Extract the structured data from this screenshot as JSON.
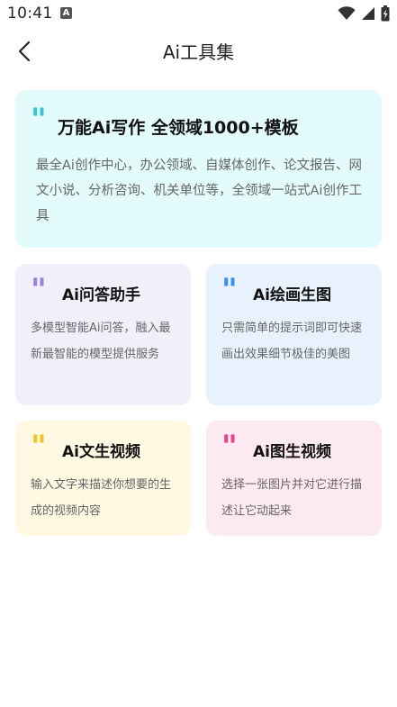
{
  "status_bar": {
    "time": "10:41",
    "notification_glyph": "A"
  },
  "header": {
    "title": "Ai工具集"
  },
  "cards": {
    "writing": {
      "title": "万能Ai写作 全领域1000+模板",
      "description": "最全Ai创作中心，办公领域、自媒体创作、论文报告、网文小说、分析咨询、机关单位等，全领域一站式Ai创作工具",
      "accent": "#34c7cf",
      "background": "#e3fbfb"
    },
    "qa": {
      "title": "Ai问答助手",
      "description": "多模型智能Ai问答，融入最新最智能的模型提供服务",
      "accent": "#9b7fe0",
      "background": "#f1effa"
    },
    "painting": {
      "title": "Ai绘画生图",
      "description": "只需简单的提示词即可快速画出效果细节极佳的美图",
      "accent": "#3b8ef0",
      "background": "#e7f2fd"
    },
    "text_video": {
      "title": "Ai文生视频",
      "description": "输入文字来描述你想要的生成的视频内容",
      "accent": "#f7c21c",
      "background": "#fff8e3"
    },
    "image_video": {
      "title": "Ai图生视频",
      "description": "选择一张图片并对它进行描述让它动起来",
      "accent": "#e8408e",
      "background": "#fde9f2"
    }
  },
  "icons": {
    "wifi": "wifi-icon",
    "signal": "signal-icon",
    "battery": "battery-icon",
    "back": "back-arrow-icon",
    "quote": "quote-icon"
  }
}
